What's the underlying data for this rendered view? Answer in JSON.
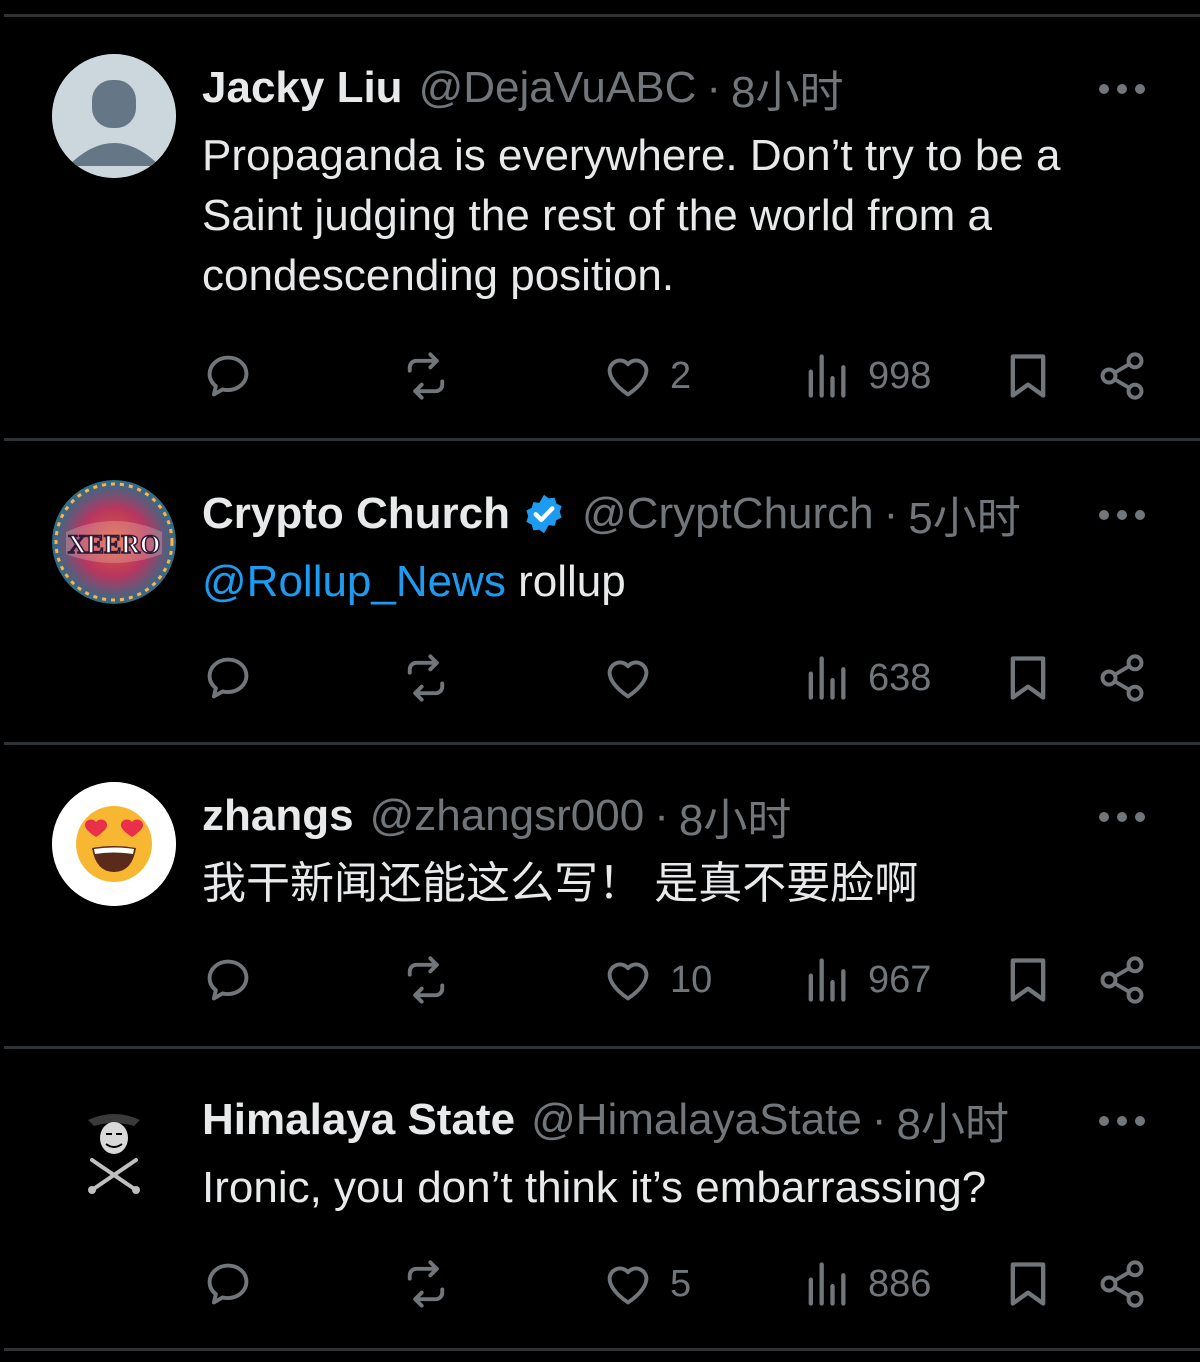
{
  "tweets": [
    {
      "name": "Jacky Liu",
      "handle": "@DejaVuABC",
      "separator": "·",
      "time": "8小时",
      "verified": false,
      "avatar_icon": "default-profile-icon",
      "text": "Propaganda is everywhere. Don’t try to be a Saint judging the rest of the world from a condescending position.",
      "mention": "",
      "likes": "2",
      "views": "998"
    },
    {
      "name": "Crypto Church",
      "handle": "@CryptChurch",
      "separator": "·",
      "time": "5小时",
      "verified": true,
      "avatar_icon": "xeero-logo-icon",
      "avatar_text": "XEERO",
      "mention": "@Rollup_News",
      "text": " rollup",
      "likes": "",
      "views": "638"
    },
    {
      "name": "zhangs",
      "handle": "@zhangsr000",
      "separator": "·",
      "time": "8小时",
      "verified": false,
      "avatar_icon": "heart-eyes-emoji-icon",
      "text": "我干新闻还能这么写！ 是真不要脸啊",
      "mention": "",
      "likes": "10",
      "views": "967"
    },
    {
      "name": "Himalaya State",
      "handle": "@HimalayaState",
      "separator": "·",
      "time": "8小时",
      "verified": false,
      "avatar_icon": "masked-figure-icon",
      "text": "Ironic, you don’t think it’s embarrassing?",
      "mention": "",
      "likes": "5",
      "views": "886"
    }
  ],
  "colors": {
    "background": "#000000",
    "primary_text": "#e7e9ea",
    "secondary_text": "#71767b",
    "link": "#1d9bf0",
    "divider": "#2f3336"
  }
}
